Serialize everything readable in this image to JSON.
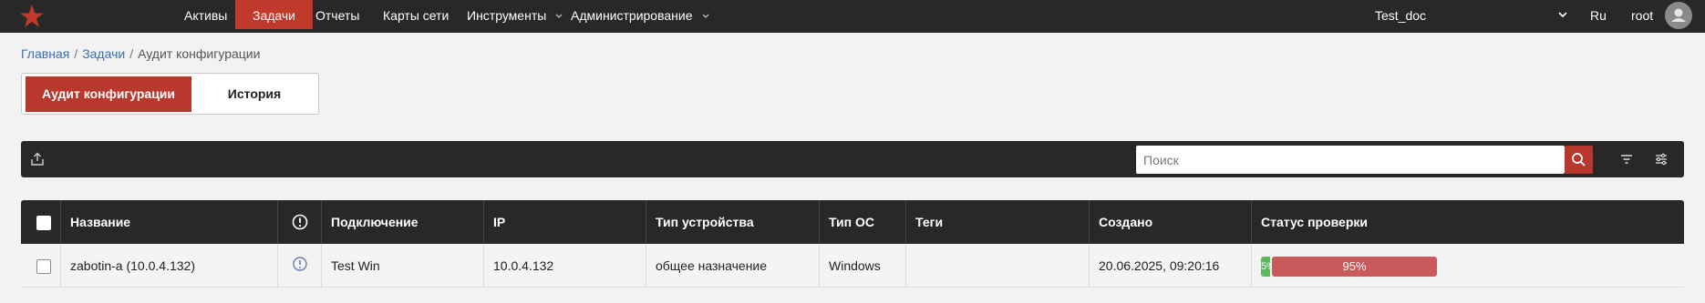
{
  "nav": {
    "items": [
      "Активы",
      "Задачи",
      "Отчеты",
      "Карты сети",
      "Инструменты",
      "Администрирование"
    ],
    "active": "Задачи",
    "workspace": "Test_doc",
    "language": "Ru",
    "user": "root"
  },
  "breadcrumb": [
    "Главная",
    "Задачи",
    "Аудит конфигурации"
  ],
  "tabs": {
    "active": "Аудит конфигурации",
    "inactive": "История"
  },
  "toolbar": {
    "search_placeholder": "Поиск"
  },
  "table": {
    "columns": [
      "Название",
      "Подключение",
      "IP",
      "Тип устройства",
      "Тип ОС",
      "Теги",
      "Создано",
      "Статус проверки"
    ],
    "rows": [
      {
        "name": "zabotin-a (10.0.4.132)",
        "connection": "Test Win",
        "ip": "10.0.4.132",
        "device_type": "общее назначение",
        "os_type": "Windows",
        "tags": "",
        "created": "20.06.2025, 09:20:16",
        "status_pass_label": "5%",
        "status_fail_label": "95%",
        "status_pass_fraction": 0.05,
        "status_fail_fraction": 0.95
      }
    ]
  },
  "colors": {
    "accent": "#b8382e",
    "topbar": "#282828",
    "pass": "#5cb85c",
    "fail": "#c9595a"
  }
}
